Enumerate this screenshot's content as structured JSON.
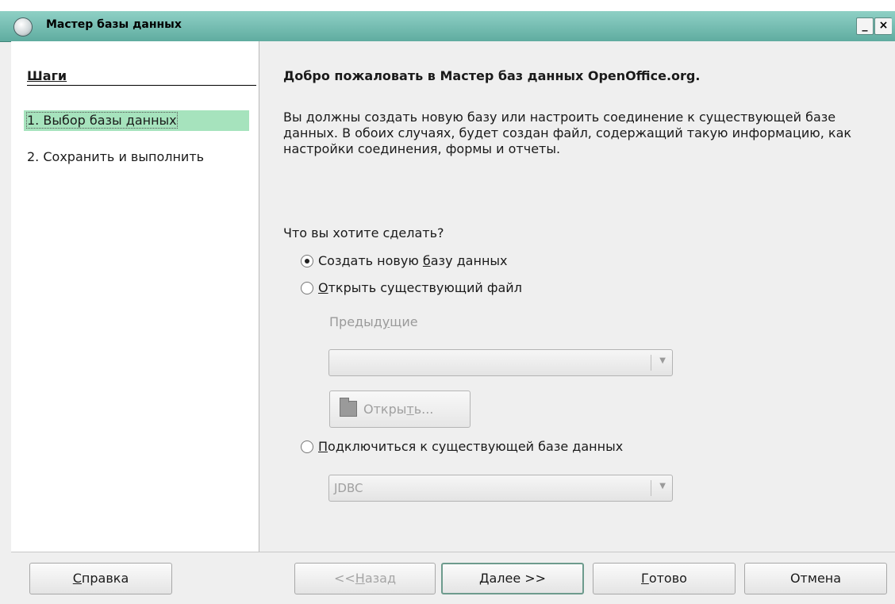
{
  "window": {
    "title": "Мастер базы данных"
  },
  "titlebar": {
    "minimize": "_",
    "close": "×"
  },
  "steps": {
    "heading": "Шаги",
    "items": [
      {
        "label": "1. Выбор базы данных"
      },
      {
        "label": "2. Сохранить и выполнить"
      }
    ]
  },
  "main": {
    "welcome": "Добро пожаловать в Мастер баз данных OpenOffice.org.",
    "description": "Вы должны создать новую базу или настроить соединение к существующей базе данных. В обоих случаях, будет создан файл, содержащий такую информацию, как настройки соединения, формы и отчеты.",
    "question": "Что вы хотите сделать?",
    "options": [
      {
        "before": "Создать новую ",
        "mnemonic": "б",
        "after": "азу данных",
        "checked": true
      },
      {
        "before": "",
        "mnemonic": "О",
        "after": "ткрыть существующий файл",
        "checked": false
      },
      {
        "before": "",
        "mnemonic": "П",
        "after": "одключиться к существующей базе данных",
        "checked": false
      }
    ],
    "recent_label": {
      "before": "Преды",
      "mnemonic": "ду",
      "after": "щие"
    },
    "recent_combo_value": "",
    "open_button": {
      "before": "Откры",
      "mnemonic": "т",
      "after": "ь..."
    },
    "connect_combo_value": "JDBC"
  },
  "buttons": {
    "help": {
      "mnemonic": "С",
      "after": "правка"
    },
    "back": {
      "before": "<<",
      "mnemonic": "Н",
      "after": "азад"
    },
    "next": {
      "mnemonic": "Д",
      "after": "алее >>"
    },
    "finish": {
      "mnemonic": "Г",
      "after": "отово"
    },
    "cancel": "Отмена"
  }
}
